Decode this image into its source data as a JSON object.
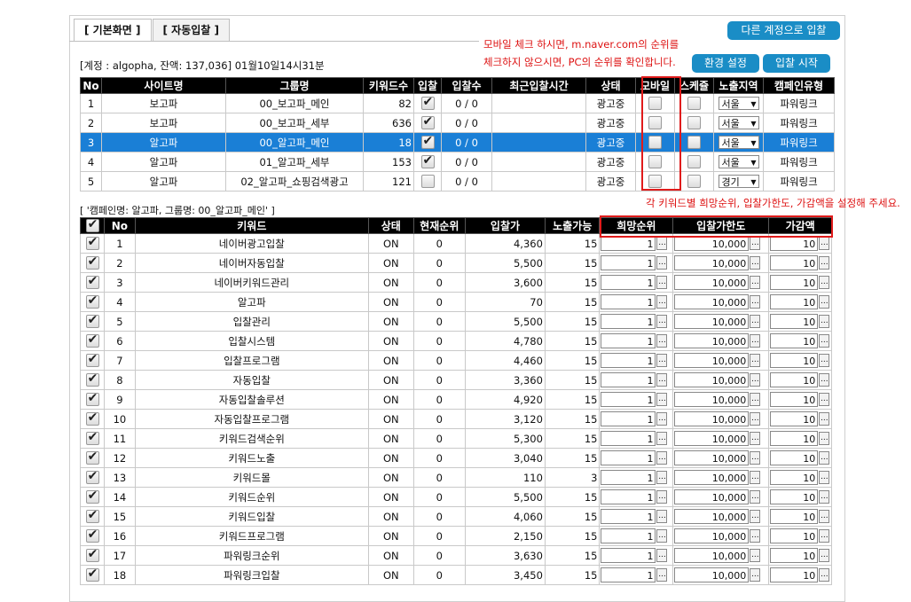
{
  "tabs": [
    "[ 기본화면 ]",
    "[ 자동입찰 ]"
  ],
  "buttons": {
    "other_account": "다른 계정으로 입찰",
    "settings": "환경 설정",
    "start": "입찰 시작"
  },
  "notes": {
    "mobile_line1": "모바일 체크 하시면, m.naver.com의 순위를",
    "mobile_line2": "체크하지 않으시면, PC의 순위를 확인합니다.",
    "keyword_hint": "각 키워드별 희망순위, 입찰가한도, 가감액을 설정해 주세요."
  },
  "account_info": "[계정 : algopha, 잔액: 137,036] 01월10일14시31분",
  "group_table": {
    "headers": [
      "No",
      "사이트명",
      "그룹명",
      "키워드수",
      "입찰",
      "입찰수",
      "최근입찰시간",
      "상태",
      "모바일",
      "스케쥴",
      "노출지역",
      "캠페인유형"
    ],
    "rows": [
      {
        "no": "1",
        "site": "보고파",
        "group": "00_보고파_메인",
        "kw": "82",
        "bid": true,
        "bids": "0 / 0",
        "time": "",
        "status": "광고중",
        "mobile": false,
        "sched": false,
        "region": "서울",
        "ctype": "파워링크"
      },
      {
        "no": "2",
        "site": "보고파",
        "group": "00_보고파_세부",
        "kw": "636",
        "bid": true,
        "bids": "0 / 0",
        "time": "",
        "status": "광고중",
        "mobile": false,
        "sched": false,
        "region": "서울",
        "ctype": "파워링크"
      },
      {
        "no": "3",
        "site": "알고파",
        "group": "00_알고파_메인",
        "kw": "18",
        "bid": true,
        "bids": "0 / 0",
        "time": "",
        "status": "광고중",
        "mobile": false,
        "sched": false,
        "region": "서울",
        "ctype": "파워링크"
      },
      {
        "no": "4",
        "site": "알고파",
        "group": "01_알고파_세부",
        "kw": "153",
        "bid": true,
        "bids": "0 / 0",
        "time": "",
        "status": "광고중",
        "mobile": false,
        "sched": false,
        "region": "서울",
        "ctype": "파워링크"
      },
      {
        "no": "5",
        "site": "알고파",
        "group": "02_알고파_쇼핑검색광고",
        "kw": "121",
        "bid": false,
        "bids": "0 / 0",
        "time": "",
        "status": "광고중",
        "mobile": false,
        "sched": false,
        "region": "경기",
        "ctype": "파워링크"
      }
    ],
    "selected_row": 2
  },
  "campaign_label": "[ '캠페인명: 알고파, 그룹명: 00_알고파_메인' ]",
  "keyword_table": {
    "headers": [
      "No",
      "키워드",
      "상태",
      "현재순위",
      "입찰가",
      "노출가능",
      "희망순위",
      "입찰가한도",
      "가감액"
    ],
    "rows": [
      {
        "no": "1",
        "kw": "네이버광고입찰",
        "st": "ON",
        "rank": "0",
        "price": "4,360",
        "exp": "15",
        "want": "1",
        "limit": "10,000",
        "delta": "10"
      },
      {
        "no": "2",
        "kw": "네이버자동입찰",
        "st": "ON",
        "rank": "0",
        "price": "5,500",
        "exp": "15",
        "want": "1",
        "limit": "10,000",
        "delta": "10"
      },
      {
        "no": "3",
        "kw": "네이버키워드관리",
        "st": "ON",
        "rank": "0",
        "price": "3,600",
        "exp": "15",
        "want": "1",
        "limit": "10,000",
        "delta": "10"
      },
      {
        "no": "4",
        "kw": "알고파",
        "st": "ON",
        "rank": "0",
        "price": "70",
        "exp": "15",
        "want": "1",
        "limit": "10,000",
        "delta": "10"
      },
      {
        "no": "5",
        "kw": "입찰관리",
        "st": "ON",
        "rank": "0",
        "price": "5,500",
        "exp": "15",
        "want": "1",
        "limit": "10,000",
        "delta": "10"
      },
      {
        "no": "6",
        "kw": "입찰시스템",
        "st": "ON",
        "rank": "0",
        "price": "4,780",
        "exp": "15",
        "want": "1",
        "limit": "10,000",
        "delta": "10"
      },
      {
        "no": "7",
        "kw": "입찰프로그램",
        "st": "ON",
        "rank": "0",
        "price": "4,460",
        "exp": "15",
        "want": "1",
        "limit": "10,000",
        "delta": "10"
      },
      {
        "no": "8",
        "kw": "자동입찰",
        "st": "ON",
        "rank": "0",
        "price": "3,360",
        "exp": "15",
        "want": "1",
        "limit": "10,000",
        "delta": "10"
      },
      {
        "no": "9",
        "kw": "자동입찰솔루션",
        "st": "ON",
        "rank": "0",
        "price": "4,920",
        "exp": "15",
        "want": "1",
        "limit": "10,000",
        "delta": "10"
      },
      {
        "no": "10",
        "kw": "자동입찰프로그램",
        "st": "ON",
        "rank": "0",
        "price": "3,120",
        "exp": "15",
        "want": "1",
        "limit": "10,000",
        "delta": "10"
      },
      {
        "no": "11",
        "kw": "키워드검색순위",
        "st": "ON",
        "rank": "0",
        "price": "5,300",
        "exp": "15",
        "want": "1",
        "limit": "10,000",
        "delta": "10"
      },
      {
        "no": "12",
        "kw": "키워드노출",
        "st": "ON",
        "rank": "0",
        "price": "3,040",
        "exp": "15",
        "want": "1",
        "limit": "10,000",
        "delta": "10"
      },
      {
        "no": "13",
        "kw": "키워드몰",
        "st": "ON",
        "rank": "0",
        "price": "110",
        "exp": "3",
        "want": "1",
        "limit": "10,000",
        "delta": "10"
      },
      {
        "no": "14",
        "kw": "키워드순위",
        "st": "ON",
        "rank": "0",
        "price": "5,500",
        "exp": "15",
        "want": "1",
        "limit": "10,000",
        "delta": "10"
      },
      {
        "no": "15",
        "kw": "키워드입찰",
        "st": "ON",
        "rank": "0",
        "price": "4,060",
        "exp": "15",
        "want": "1",
        "limit": "10,000",
        "delta": "10"
      },
      {
        "no": "16",
        "kw": "키워드프로그램",
        "st": "ON",
        "rank": "0",
        "price": "2,150",
        "exp": "15",
        "want": "1",
        "limit": "10,000",
        "delta": "10"
      },
      {
        "no": "17",
        "kw": "파워링크순위",
        "st": "ON",
        "rank": "0",
        "price": "3,630",
        "exp": "15",
        "want": "1",
        "limit": "10,000",
        "delta": "10"
      },
      {
        "no": "18",
        "kw": "파워링크입찰",
        "st": "ON",
        "rank": "0",
        "price": "3,450",
        "exp": "15",
        "want": "1",
        "limit": "10,000",
        "delta": "10"
      }
    ]
  },
  "dots_label": "...",
  "colors": {
    "button": "#1a8dc6",
    "selected_row": "#1a7fd6",
    "highlight": "#e01b1b",
    "note": "#d11111"
  }
}
